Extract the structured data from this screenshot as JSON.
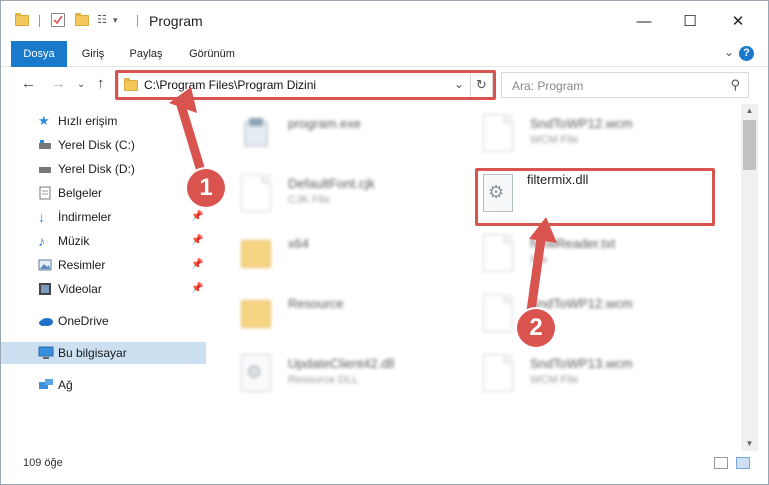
{
  "window": {
    "title": "Program",
    "controls": {
      "minimize": "—",
      "maximize": "☐",
      "close": "✕"
    }
  },
  "ribbon": {
    "tabs": [
      {
        "label": "Dosya",
        "active": true
      },
      {
        "label": "Giriş"
      },
      {
        "label": "Paylaş"
      },
      {
        "label": "Görünüm"
      }
    ],
    "help": "?"
  },
  "address": {
    "path": "C:\\Program Files\\Program Dizini"
  },
  "search": {
    "placeholder": "Ara: Program"
  },
  "sidebar": {
    "items": [
      {
        "label": "Hızlı erişim",
        "icon": "star-icon"
      },
      {
        "label": "Yerel Disk (C:)",
        "icon": "drive-icon"
      },
      {
        "label": "Yerel Disk (D:)",
        "icon": "drive-icon"
      },
      {
        "label": "Belgeler",
        "icon": "documents-icon"
      },
      {
        "label": "İndirmeler",
        "icon": "download-icon",
        "pinned": true
      },
      {
        "label": "Müzik",
        "icon": "music-icon",
        "pinned": true
      },
      {
        "label": "Resimler",
        "icon": "pictures-icon",
        "pinned": true
      },
      {
        "label": "Videolar",
        "icon": "video-icon",
        "pinned": true
      },
      {
        "label": "OneDrive",
        "icon": "cloud-icon"
      },
      {
        "label": "Bu bilgisayar",
        "icon": "computer-icon",
        "selected": true
      },
      {
        "label": "Ağ",
        "icon": "network-icon"
      }
    ]
  },
  "files": [
    {
      "name": "program.exe",
      "type": "",
      "icon": "exe-icon"
    },
    {
      "name": "SndToWP12.wcm",
      "type": "WCM File",
      "icon": "document-icon"
    },
    {
      "name": "DefaultFont.cjk",
      "type": "CJK File",
      "icon": "document-icon"
    },
    {
      "name": "filtermix.dll",
      "type": "",
      "icon": "dll-gear-icon"
    },
    {
      "name": "x64",
      "type": "",
      "icon": "folder-icon"
    },
    {
      "name": "NewReader.txt",
      "type": "File",
      "icon": "document-icon"
    },
    {
      "name": "Resource",
      "type": "",
      "icon": "folder-icon"
    },
    {
      "name": "SndToWP12.wcm",
      "type": "File",
      "icon": "document-icon"
    },
    {
      "name": "UpdateClient42.dll",
      "type": "Resource DLL",
      "icon": "dll-gear-icon"
    },
    {
      "name": "SndToWP13.wcm",
      "type": "WCM File",
      "icon": "document-icon"
    }
  ],
  "status": {
    "item_count": "109 öğe"
  },
  "callouts": {
    "one": "1",
    "two": "2"
  },
  "colors": {
    "accent": "#1979ca",
    "highlight": "#d9534f",
    "selected": "#cde0f2"
  }
}
